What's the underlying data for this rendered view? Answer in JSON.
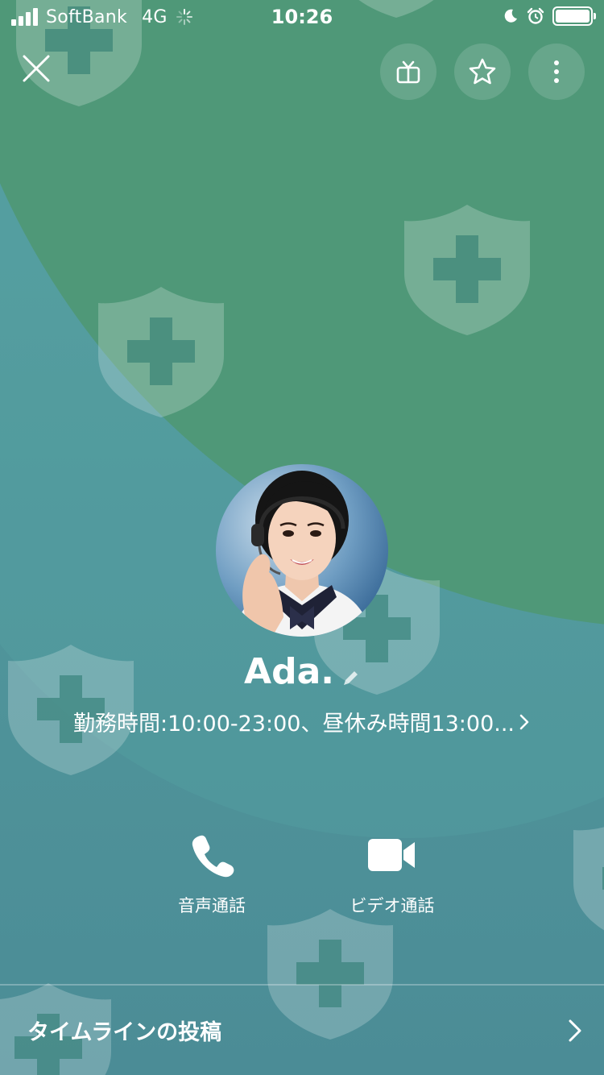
{
  "status_bar": {
    "carrier": "SoftBank",
    "network": "4G",
    "time": "10:26",
    "icons": [
      "signal-icon",
      "loading-icon",
      "moon-icon",
      "alarm-icon",
      "battery-icon"
    ]
  },
  "nav": {
    "icons": [
      "close-icon",
      "gift-icon",
      "star-icon",
      "more-icon"
    ]
  },
  "profile": {
    "name": "Ada.",
    "status_message": "勤務時間:10:00-23:00、昼休み時間13:00..."
  },
  "actions": {
    "voice_call_label": "音声通話",
    "video_call_label": "ビデオ通話"
  },
  "timeline": {
    "label": "タイムラインの投稿"
  },
  "colors": {
    "bg_teal": "#4f9094",
    "bg_green": "#4f9878",
    "text": "#ffffff"
  }
}
